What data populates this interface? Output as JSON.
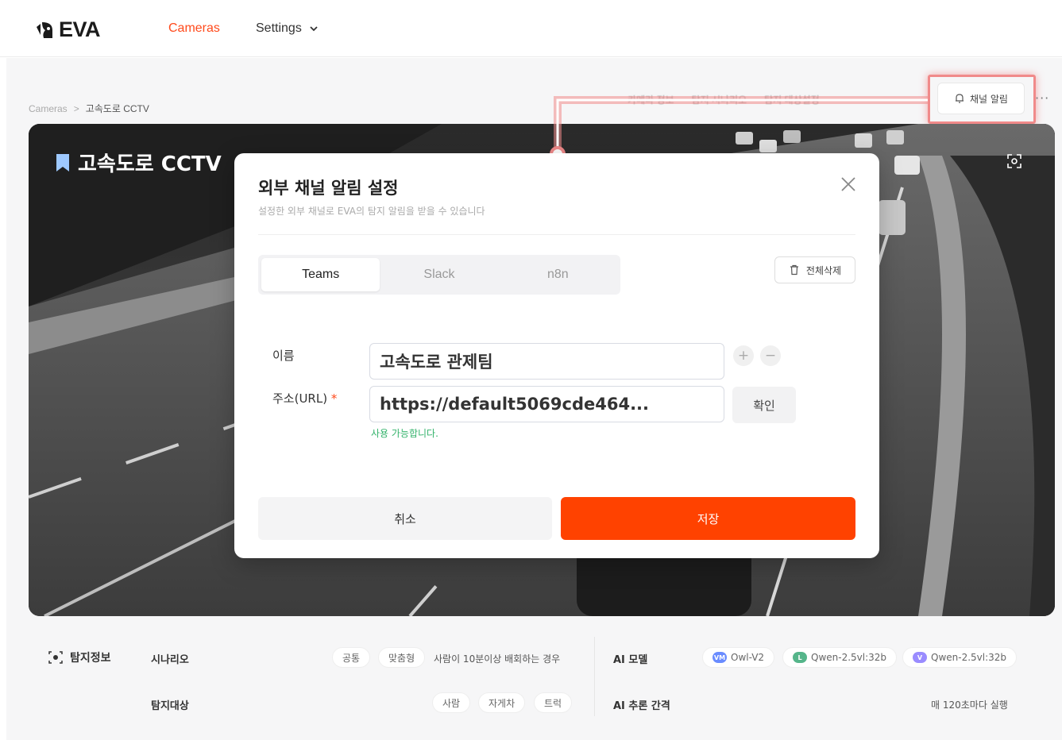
{
  "nav": {
    "logo_text": "EVA",
    "cameras_label": "Cameras",
    "settings_label": "Settings"
  },
  "breadcrumb": {
    "root": "Cameras",
    "separator": ">",
    "current": "고속도로 CCTV"
  },
  "toolbar": {
    "items": [
      "카메라 정보",
      "탐지 시나리오",
      "탐지 대상설정"
    ],
    "channel_alert_label": "채널 알림",
    "more_label": "···"
  },
  "camera": {
    "title": "고속도로 CCTV"
  },
  "modal": {
    "title": "외부 채널 알림 설정",
    "subtitle": "설정한 외부 채널로 EVA의 탐지 알림을 받을 수 있습니다",
    "tabs": [
      {
        "label": "Teams",
        "active": true
      },
      {
        "label": "Slack",
        "active": false
      },
      {
        "label": "n8n",
        "active": false
      }
    ],
    "delete_all_label": "전체삭제",
    "name_label": "이름",
    "name_value": "고속도로 관제팀",
    "url_label": "주소(URL)",
    "required_mark": "*",
    "url_value": "https://default5069cde464...",
    "plus_label": "+",
    "minus_label": "−",
    "confirm_label": "확인",
    "hint": "사용 가능합니다.",
    "cancel_label": "취소",
    "save_label": "저장"
  },
  "detection": {
    "title": "탐지정보",
    "scenario_label": "시나리오",
    "scenario_chips": [
      "공통",
      "맞춤형"
    ],
    "scenario_text": "사람이 10분이상 배회하는 경우",
    "targets_label": "탐지대상",
    "target_chips": [
      "사람",
      "자게차",
      "트럭"
    ],
    "ai_model_label": "AI 모델",
    "ai_models": [
      {
        "badge": "VM",
        "name": "Owl-V2"
      },
      {
        "badge": "L",
        "name": "Qwen-2.5vl:32b"
      },
      {
        "badge": "V",
        "name": "Qwen-2.5vl:32b"
      }
    ],
    "interval_label": "AI 추론 간격",
    "interval_value": "매 120초마다 실행"
  },
  "colors": {
    "accent": "#ff4200",
    "highlight": "#f08a8a",
    "success": "#34b36b"
  }
}
